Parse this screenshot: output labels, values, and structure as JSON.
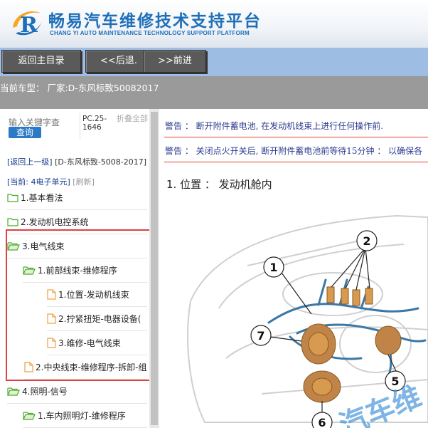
{
  "header": {
    "title": "畅易汽车维修技术支持平台",
    "subtitle": "CHANG YI AUTO MAINTENANCE TECHNOLOGY SUPPORT PLATFORM"
  },
  "toolbar": {
    "back_main": "返回主目录",
    "back": "<<后退.",
    "forward": ">>前进"
  },
  "infobar": {
    "current_model": "当前车型： 厂家:D-东风标致50082017"
  },
  "search": {
    "placeholder": "输入关键字查",
    "button": "查询",
    "pc_code": "PC.25-1646",
    "collapse_all": "折叠全部"
  },
  "nav": {
    "back_up": "[返回上一级]",
    "car_path": "[D-东风标致-5008-2017]",
    "current": "[当前: 4电子单元]",
    "refresh": "[刷新]"
  },
  "tree": [
    {
      "label": "1.基本看法",
      "type": "folder",
      "open": false
    },
    {
      "label": "2.发动机电控系统",
      "type": "folder",
      "open": false
    },
    {
      "label": "3.电气线束",
      "type": "folder",
      "open": true
    },
    {
      "label": "1.前部线束-维修程序",
      "type": "folder",
      "open": true
    },
    {
      "label": "1.位置-发动机线束",
      "type": "doc"
    },
    {
      "label": "2.拧紧扭矩-电器设备(",
      "type": "doc"
    },
    {
      "label": "3.维修-电气线束",
      "type": "doc"
    },
    {
      "label": "2.中央线束-维修程序-拆卸-组",
      "type": "doc"
    },
    {
      "label": "4.照明-信号",
      "type": "folder",
      "open": true
    },
    {
      "label": "1.车内照明灯-维修程序",
      "type": "folder",
      "open": true
    }
  ],
  "content": {
    "warning1": "警告 ： 断开附件蓄电池, 在发动机线束上进行任何操作前.",
    "warning2": "警告 ： 关闭点火开关后, 断开附件蓄电池前等待15分钟 ： 以确保各",
    "heading": "1. 位置 ： 发动机舱内",
    "callouts": [
      "1",
      "2",
      "5",
      "6",
      "7"
    ],
    "watermark": "汽车维"
  },
  "colors": {
    "brand": "#1f6fb8",
    "toolbar_bg": "#9dbde3",
    "button_bg": "#5a5a5a",
    "infobar_bg": "#9a9a9a",
    "highlight": "#e0403f",
    "link": "#1a3d8f",
    "folder_green": "#4caa2c",
    "doc_orange": "#f0a040"
  }
}
